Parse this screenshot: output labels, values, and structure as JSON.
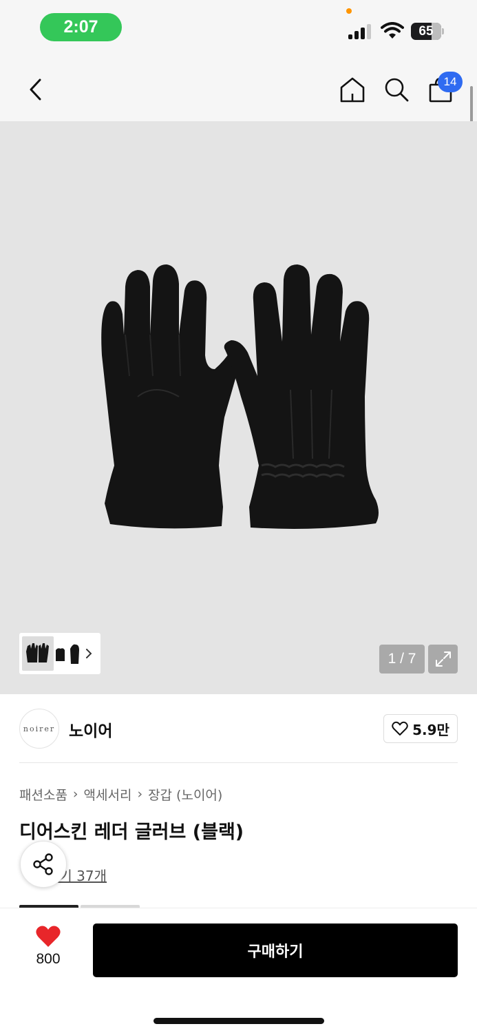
{
  "status_bar": {
    "time": "2:07",
    "battery": "65",
    "accent_color": "#34c759"
  },
  "nav": {
    "back_icon": "chevron-left-icon",
    "home_icon": "home-icon",
    "search_icon": "search-icon",
    "cart_icon": "shopping-bag-icon",
    "cart_count": "14",
    "badge_color": "#2f6bf1"
  },
  "gallery": {
    "pager": "1 / 7",
    "expand_icon": "expand-icon"
  },
  "brand": {
    "logo_text": "noirer",
    "name": "노이어",
    "like_count": "5.9만"
  },
  "product": {
    "breadcrumb": [
      "패션소품",
      "액세서리",
      "장갑 (노이어)"
    ],
    "title": "디어스킨 레더 글러브 (블랙)",
    "review_text": "후기 37개"
  },
  "bottom_bar": {
    "wish_count": "800",
    "wish_color": "#e8262a",
    "buy_label": "구매하기"
  }
}
